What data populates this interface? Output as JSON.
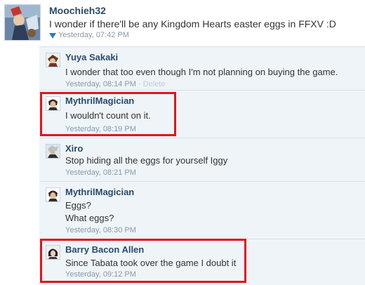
{
  "post": {
    "author": "Moochieh32",
    "text": "I wonder if there'll be any Kingdom Hearts easter eggs in FFXV :D",
    "timestamp": "Yesterday, 07:42 PM"
  },
  "comments": [
    {
      "author": "Yuya Sakaki",
      "lines": [
        "I wonder that too even though I'm not planning on buying the game."
      ],
      "timestamp": "Yesterday, 08:14 PM",
      "delete_label": "Delete",
      "separator": "·"
    },
    {
      "author": "MythrilMagician",
      "lines": [
        "I wouldn't count on it."
      ],
      "timestamp": "Yesterday, 08:19 PM"
    },
    {
      "author": "Xiro",
      "lines": [
        "Stop hiding all the eggs for yourself Iggy"
      ],
      "timestamp": "Yesterday, 08:21 PM"
    },
    {
      "author": "MythrilMagician",
      "lines": [
        "Eggs?",
        "What eggs?"
      ],
      "timestamp": "Yesterday, 08:30 PM"
    },
    {
      "author": "Barry Bacon Allen",
      "lines": [
        "Since Tabata took over the game I doubt it"
      ],
      "timestamp": "Yesterday, 09:12 PM"
    }
  ],
  "colors": {
    "name": "#2b4a6b",
    "highlight_box": "#e0161b",
    "comment_bg": "#eef4f8"
  }
}
